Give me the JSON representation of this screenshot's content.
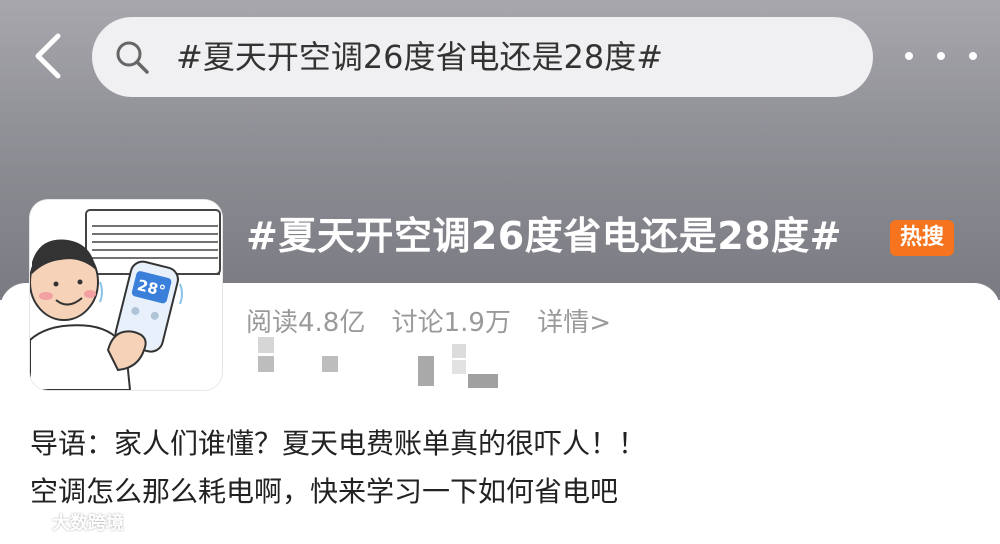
{
  "header": {
    "search_query": "#夏天开空调26度省电还是28度#"
  },
  "topic": {
    "title": "#夏天开空调26度省电还是28度#",
    "badge": "热搜",
    "avatar_display_text": "28°",
    "stats": {
      "reads": "阅读4.8亿",
      "discussions": "讨论1.9万",
      "details_link": "详情>"
    }
  },
  "intro": {
    "line1": "导语：家人们谁懂？夏天电费账单真的很吓人！！",
    "line2": "空调怎么那么耗电啊，快来学习一下如何省电吧"
  },
  "watermark": {
    "text": "大数跨境"
  },
  "colors": {
    "header_gradient_top": "#a7a7ad",
    "header_gradient_bottom": "#7a7a82",
    "hot_badge": "#f5741d",
    "stats_text": "#9a9a9a",
    "body_text": "#222222"
  },
  "icons": {
    "back": "chevron-left-icon",
    "search": "search-icon",
    "more": "more-horizontal-icon"
  }
}
